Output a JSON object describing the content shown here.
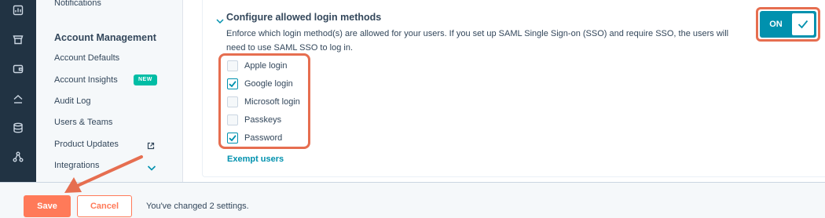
{
  "rail": {
    "icons": [
      "dashboard-icon",
      "store-icon",
      "wallet-icon",
      "home-icon",
      "database-icon",
      "org-icon"
    ]
  },
  "sidebar": {
    "top_item": "Notifications",
    "heading": "Account Management",
    "items": [
      {
        "label": "Account Defaults"
      },
      {
        "label": "Account Insights",
        "badge": "NEW"
      },
      {
        "label": "Audit Log"
      },
      {
        "label": "Users & Teams"
      },
      {
        "label": "Product Updates",
        "icon": "external-link-icon"
      },
      {
        "label": "Integrations",
        "icon": "chevron-down-icon"
      }
    ]
  },
  "section": {
    "title": "Configure allowed login methods",
    "description": "Enforce which login method(s) are allowed for your users. If you set up SAML Single Sign-on (SSO) and require SSO, the users will need to use SAML SSO to log in.",
    "toggle": {
      "label": "ON",
      "state": "on"
    },
    "options": [
      {
        "label": "Apple login",
        "checked": false
      },
      {
        "label": "Google login",
        "checked": true
      },
      {
        "label": "Microsoft login",
        "checked": false
      },
      {
        "label": "Passkeys",
        "checked": false
      },
      {
        "label": "Password",
        "checked": true
      }
    ],
    "exempt_link": "Exempt users"
  },
  "footer": {
    "save_label": "Save",
    "cancel_label": "Cancel",
    "message": "You've changed 2 settings."
  },
  "colors": {
    "accent": "#0091ae",
    "primary_button": "#ff7a59",
    "annotation": "#e66e50",
    "rail": "#213343"
  }
}
